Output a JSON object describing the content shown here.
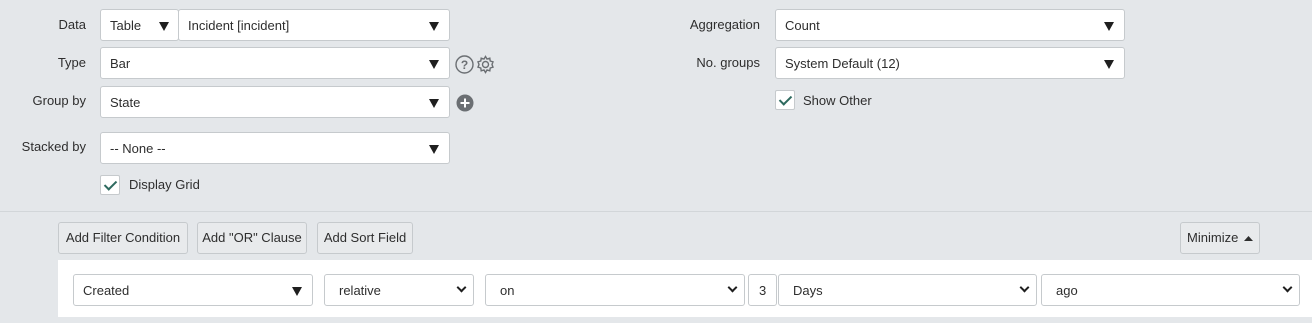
{
  "left": {
    "data_label": "Data",
    "data_source_value": "Table",
    "data_table_value": "Incident [incident]",
    "type_label": "Type",
    "type_value": "Bar",
    "group_by_label": "Group by",
    "group_by_value": "State",
    "stacked_by_label": "Stacked by",
    "stacked_by_value": "-- None --",
    "display_grid_label": "Display Grid"
  },
  "right": {
    "aggregation_label": "Aggregation",
    "aggregation_value": "Count",
    "no_groups_label": "No. groups",
    "no_groups_value": "System Default (12)",
    "show_other_label": "Show Other"
  },
  "checkboxes": {
    "display_grid": true,
    "show_other": true
  },
  "icons": {
    "help": "question-circle-icon",
    "settings": "gear-icon",
    "add_group": "plus-circle-icon"
  },
  "filter_toolbar": {
    "add_filter_label": "Add Filter Condition",
    "add_or_label": "Add \"OR\" Clause",
    "add_sort_label": "Add Sort Field",
    "minimize_label": "Minimize"
  },
  "condition": {
    "field": "Created",
    "operator": "relative",
    "direction": "on",
    "quantity": "3",
    "unit": "Days",
    "when": "ago"
  }
}
